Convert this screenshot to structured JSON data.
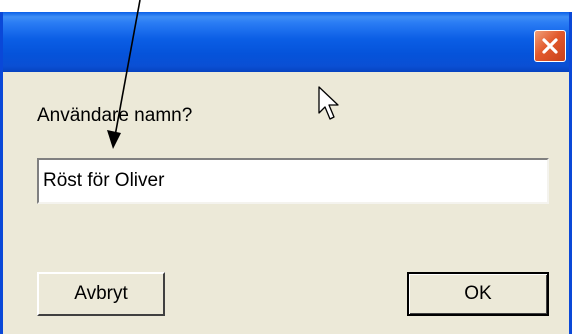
{
  "dialog": {
    "title": "",
    "close_icon": "close-icon",
    "prompt": "Användare namn?",
    "input": {
      "value": "Röst för Oliver",
      "placeholder": ""
    },
    "buttons": {
      "cancel_label": "Avbryt",
      "ok_label": "OK"
    }
  },
  "colors": {
    "title_bar": "#0b5ee5",
    "window_border": "#0a48d8",
    "dialog_bg": "#ece9d8",
    "close_button": "#e2592c"
  },
  "overlays": {
    "cursor_icon": "mouse-pointer-icon",
    "annotation_icon": "annotation-arrow-icon"
  }
}
